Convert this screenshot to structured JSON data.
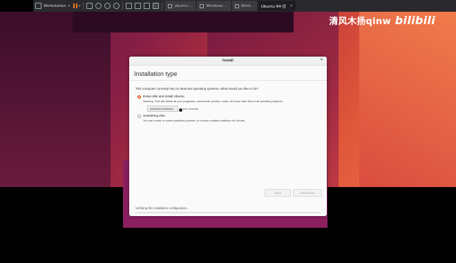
{
  "vm_toolbar": {
    "app_menu_label": "Workstation",
    "tabs": [
      {
        "label": "ubuntu-...",
        "active": false
      },
      {
        "label": "Windows ...",
        "active": false
      },
      {
        "label": "Wind...",
        "active": false
      },
      {
        "label": "Ubuntu 64-位",
        "active": true
      }
    ]
  },
  "watermark": {
    "text": "清风木扬qinw",
    "logo": "bilibili"
  },
  "dialog": {
    "window_title": "Install",
    "page_title": "Installation type",
    "question": "This computer currently has no detected operating systems. What would you like to do?",
    "options": [
      {
        "label": "Erase disk and install Ubuntu",
        "description": "Warning: This will delete all your programs, documents, photos, music, and any other files in all operating systems.",
        "selected": true
      },
      {
        "label": "Something else",
        "description": "You can create or resize partitions yourself, or choose multiple partitions for Ubuntu.",
        "selected": false
      }
    ],
    "advanced_button_label": "Advanced features...",
    "advanced_status": "None selected",
    "back_button_label": "Back",
    "install_button_label": "Install Now",
    "status_text": "Verifying the installation configuration...",
    "progress": 0.0
  },
  "colors": {
    "accent": "#e95420",
    "toolbar_bg": "#2a2a2e"
  }
}
